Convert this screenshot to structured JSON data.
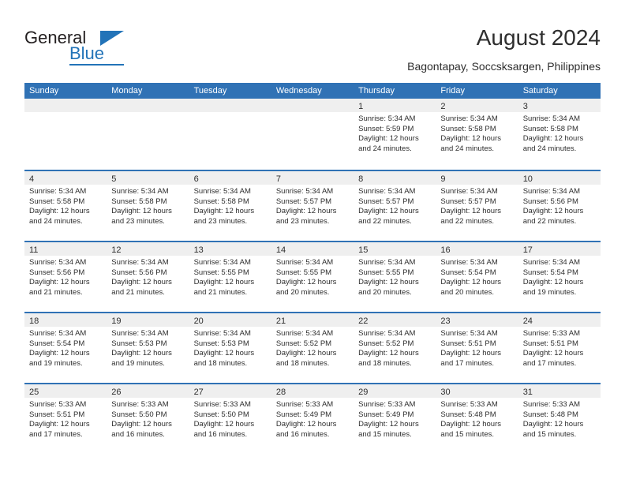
{
  "brand": {
    "name_part1": "General",
    "name_part2": "Blue",
    "accent_color": "#2273b8",
    "triangle_icon": "triangle-icon"
  },
  "header": {
    "title": "August 2024",
    "subtitle": "Bagontapay, Soccsksargen, Philippines"
  },
  "calendar": {
    "header_color": "#3072b5",
    "day_band_color": "#efefef",
    "weekdays": [
      "Sunday",
      "Monday",
      "Tuesday",
      "Wednesday",
      "Thursday",
      "Friday",
      "Saturday"
    ],
    "weeks": [
      [
        {
          "day": "",
          "empty": true,
          "lines": []
        },
        {
          "day": "",
          "empty": true,
          "lines": []
        },
        {
          "day": "",
          "empty": true,
          "lines": []
        },
        {
          "day": "",
          "empty": true,
          "lines": []
        },
        {
          "day": "1",
          "empty": false,
          "lines": [
            "Sunrise: 5:34 AM",
            "Sunset: 5:59 PM",
            "Daylight: 12 hours",
            "and 24 minutes."
          ]
        },
        {
          "day": "2",
          "empty": false,
          "lines": [
            "Sunrise: 5:34 AM",
            "Sunset: 5:58 PM",
            "Daylight: 12 hours",
            "and 24 minutes."
          ]
        },
        {
          "day": "3",
          "empty": false,
          "lines": [
            "Sunrise: 5:34 AM",
            "Sunset: 5:58 PM",
            "Daylight: 12 hours",
            "and 24 minutes."
          ]
        }
      ],
      [
        {
          "day": "4",
          "empty": false,
          "lines": [
            "Sunrise: 5:34 AM",
            "Sunset: 5:58 PM",
            "Daylight: 12 hours",
            "and 24 minutes."
          ]
        },
        {
          "day": "5",
          "empty": false,
          "lines": [
            "Sunrise: 5:34 AM",
            "Sunset: 5:58 PM",
            "Daylight: 12 hours",
            "and 23 minutes."
          ]
        },
        {
          "day": "6",
          "empty": false,
          "lines": [
            "Sunrise: 5:34 AM",
            "Sunset: 5:58 PM",
            "Daylight: 12 hours",
            "and 23 minutes."
          ]
        },
        {
          "day": "7",
          "empty": false,
          "lines": [
            "Sunrise: 5:34 AM",
            "Sunset: 5:57 PM",
            "Daylight: 12 hours",
            "and 23 minutes."
          ]
        },
        {
          "day": "8",
          "empty": false,
          "lines": [
            "Sunrise: 5:34 AM",
            "Sunset: 5:57 PM",
            "Daylight: 12 hours",
            "and 22 minutes."
          ]
        },
        {
          "day": "9",
          "empty": false,
          "lines": [
            "Sunrise: 5:34 AM",
            "Sunset: 5:57 PM",
            "Daylight: 12 hours",
            "and 22 minutes."
          ]
        },
        {
          "day": "10",
          "empty": false,
          "lines": [
            "Sunrise: 5:34 AM",
            "Sunset: 5:56 PM",
            "Daylight: 12 hours",
            "and 22 minutes."
          ]
        }
      ],
      [
        {
          "day": "11",
          "empty": false,
          "lines": [
            "Sunrise: 5:34 AM",
            "Sunset: 5:56 PM",
            "Daylight: 12 hours",
            "and 21 minutes."
          ]
        },
        {
          "day": "12",
          "empty": false,
          "lines": [
            "Sunrise: 5:34 AM",
            "Sunset: 5:56 PM",
            "Daylight: 12 hours",
            "and 21 minutes."
          ]
        },
        {
          "day": "13",
          "empty": false,
          "lines": [
            "Sunrise: 5:34 AM",
            "Sunset: 5:55 PM",
            "Daylight: 12 hours",
            "and 21 minutes."
          ]
        },
        {
          "day": "14",
          "empty": false,
          "lines": [
            "Sunrise: 5:34 AM",
            "Sunset: 5:55 PM",
            "Daylight: 12 hours",
            "and 20 minutes."
          ]
        },
        {
          "day": "15",
          "empty": false,
          "lines": [
            "Sunrise: 5:34 AM",
            "Sunset: 5:55 PM",
            "Daylight: 12 hours",
            "and 20 minutes."
          ]
        },
        {
          "day": "16",
          "empty": false,
          "lines": [
            "Sunrise: 5:34 AM",
            "Sunset: 5:54 PM",
            "Daylight: 12 hours",
            "and 20 minutes."
          ]
        },
        {
          "day": "17",
          "empty": false,
          "lines": [
            "Sunrise: 5:34 AM",
            "Sunset: 5:54 PM",
            "Daylight: 12 hours",
            "and 19 minutes."
          ]
        }
      ],
      [
        {
          "day": "18",
          "empty": false,
          "lines": [
            "Sunrise: 5:34 AM",
            "Sunset: 5:54 PM",
            "Daylight: 12 hours",
            "and 19 minutes."
          ]
        },
        {
          "day": "19",
          "empty": false,
          "lines": [
            "Sunrise: 5:34 AM",
            "Sunset: 5:53 PM",
            "Daylight: 12 hours",
            "and 19 minutes."
          ]
        },
        {
          "day": "20",
          "empty": false,
          "lines": [
            "Sunrise: 5:34 AM",
            "Sunset: 5:53 PM",
            "Daylight: 12 hours",
            "and 18 minutes."
          ]
        },
        {
          "day": "21",
          "empty": false,
          "lines": [
            "Sunrise: 5:34 AM",
            "Sunset: 5:52 PM",
            "Daylight: 12 hours",
            "and 18 minutes."
          ]
        },
        {
          "day": "22",
          "empty": false,
          "lines": [
            "Sunrise: 5:34 AM",
            "Sunset: 5:52 PM",
            "Daylight: 12 hours",
            "and 18 minutes."
          ]
        },
        {
          "day": "23",
          "empty": false,
          "lines": [
            "Sunrise: 5:34 AM",
            "Sunset: 5:51 PM",
            "Daylight: 12 hours",
            "and 17 minutes."
          ]
        },
        {
          "day": "24",
          "empty": false,
          "lines": [
            "Sunrise: 5:33 AM",
            "Sunset: 5:51 PM",
            "Daylight: 12 hours",
            "and 17 minutes."
          ]
        }
      ],
      [
        {
          "day": "25",
          "empty": false,
          "lines": [
            "Sunrise: 5:33 AM",
            "Sunset: 5:51 PM",
            "Daylight: 12 hours",
            "and 17 minutes."
          ]
        },
        {
          "day": "26",
          "empty": false,
          "lines": [
            "Sunrise: 5:33 AM",
            "Sunset: 5:50 PM",
            "Daylight: 12 hours",
            "and 16 minutes."
          ]
        },
        {
          "day": "27",
          "empty": false,
          "lines": [
            "Sunrise: 5:33 AM",
            "Sunset: 5:50 PM",
            "Daylight: 12 hours",
            "and 16 minutes."
          ]
        },
        {
          "day": "28",
          "empty": false,
          "lines": [
            "Sunrise: 5:33 AM",
            "Sunset: 5:49 PM",
            "Daylight: 12 hours",
            "and 16 minutes."
          ]
        },
        {
          "day": "29",
          "empty": false,
          "lines": [
            "Sunrise: 5:33 AM",
            "Sunset: 5:49 PM",
            "Daylight: 12 hours",
            "and 15 minutes."
          ]
        },
        {
          "day": "30",
          "empty": false,
          "lines": [
            "Sunrise: 5:33 AM",
            "Sunset: 5:48 PM",
            "Daylight: 12 hours",
            "and 15 minutes."
          ]
        },
        {
          "day": "31",
          "empty": false,
          "lines": [
            "Sunrise: 5:33 AM",
            "Sunset: 5:48 PM",
            "Daylight: 12 hours",
            "and 15 minutes."
          ]
        }
      ]
    ]
  }
}
